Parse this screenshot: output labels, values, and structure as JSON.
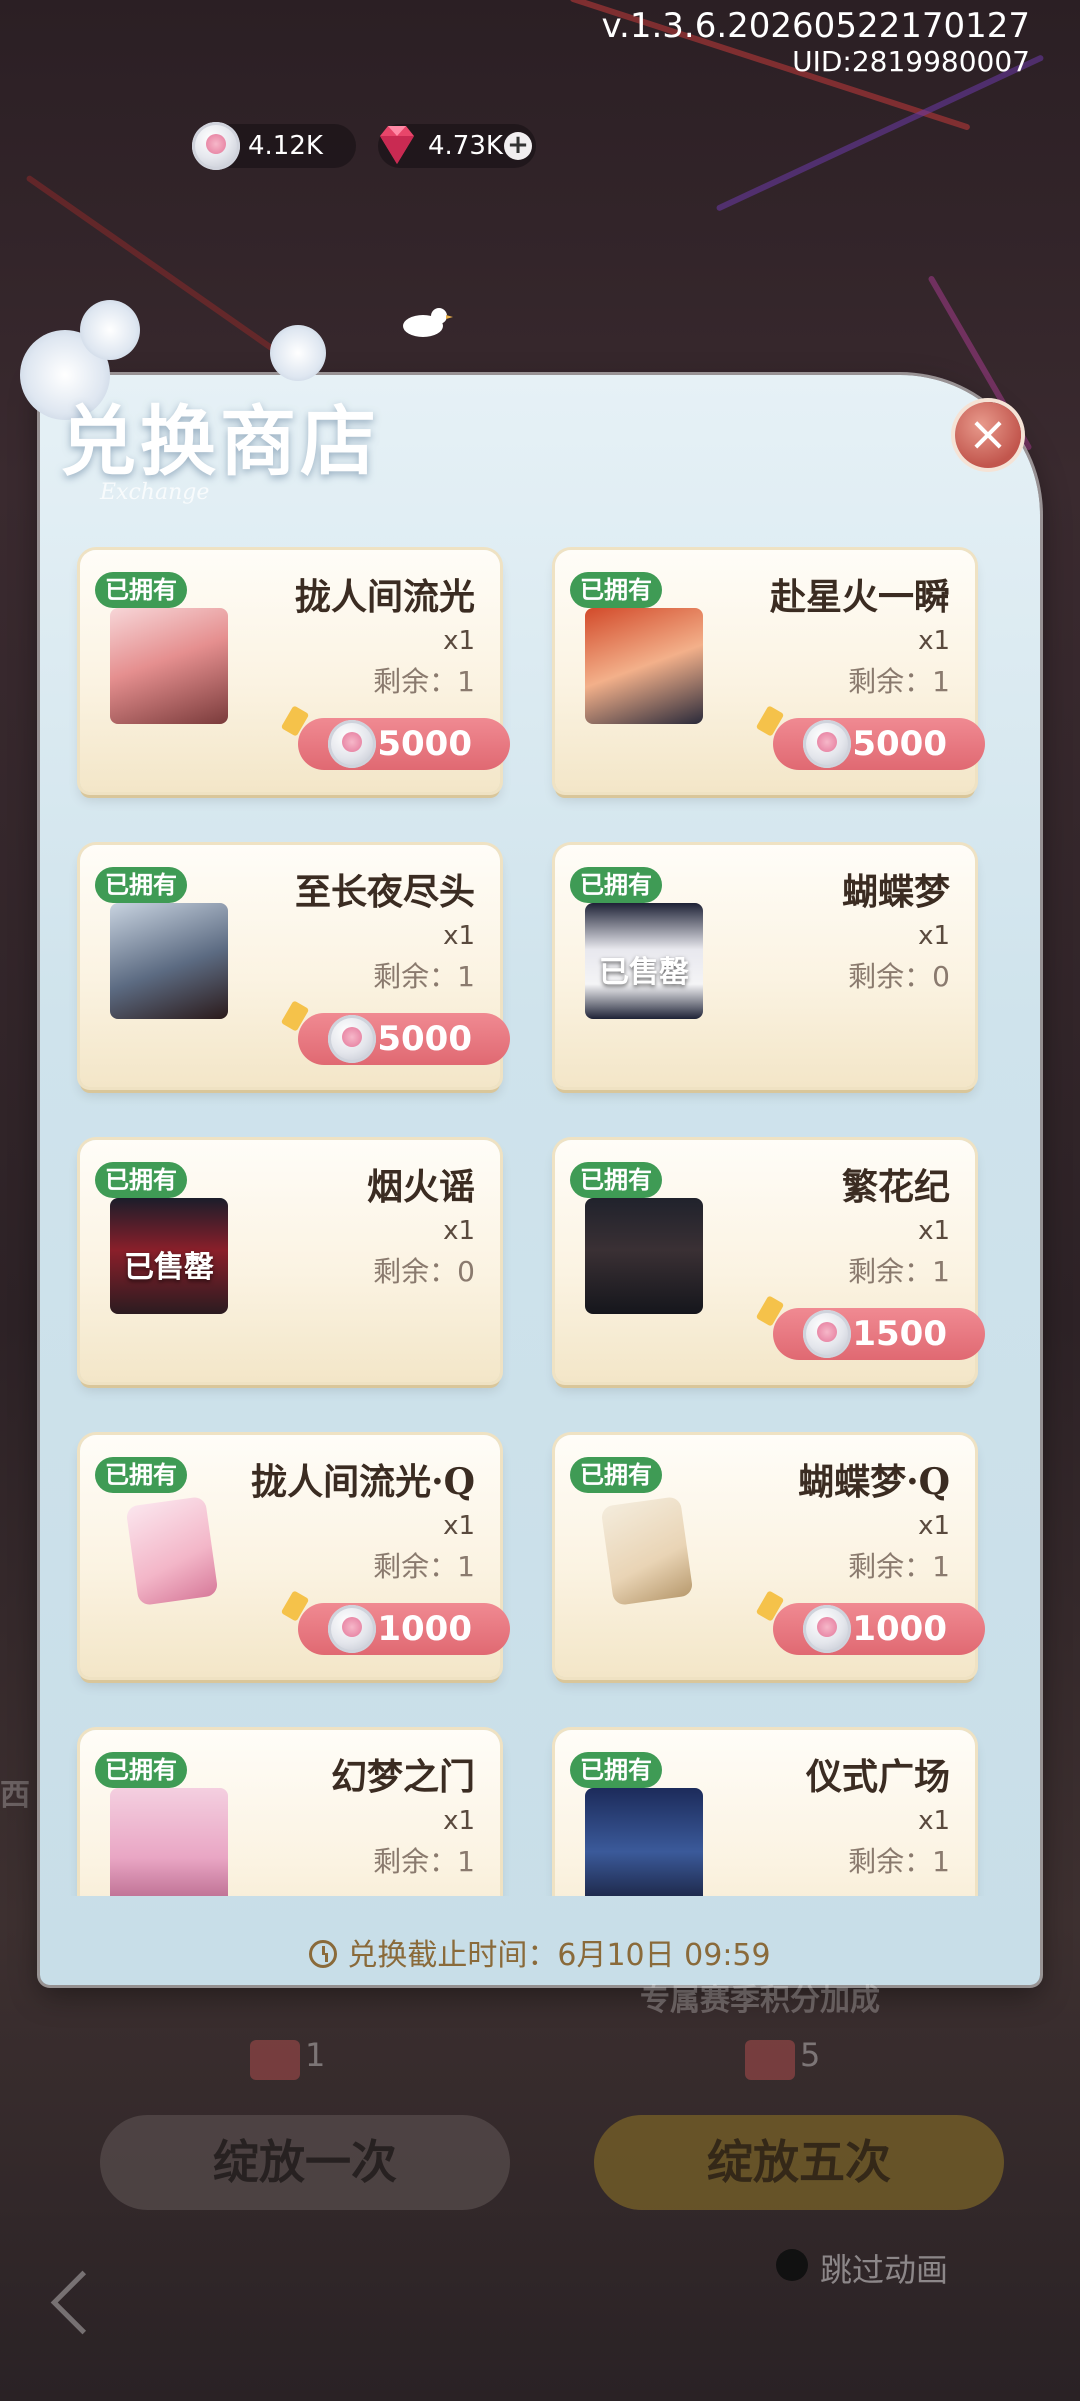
{
  "top_info": {
    "version": "v.1.3.6.20260522170127",
    "uid": "UID:2819980007"
  },
  "currencies": {
    "coin": "4.12K",
    "gem": "4.73K",
    "coin_icon": "silver-rose-coin-icon",
    "gem_icon": "pink-diamond-icon"
  },
  "shop": {
    "title": "兑换商店",
    "subtitle": "Exchange",
    "close_icon": "close-icon",
    "owned_label": "已拥有",
    "sold_out_label": "已售罄",
    "items": [
      {
        "name": "拢人间流光",
        "qty": "x1",
        "remain": "剩余：1",
        "price": "5000",
        "sold_out": false,
        "thumb": "portrait-pink-hair"
      },
      {
        "name": "赴星火一瞬",
        "qty": "x1",
        "remain": "剩余：1",
        "price": "5000",
        "sold_out": false,
        "thumb": "portrait-orange-hair"
      },
      {
        "name": "至长夜尽头",
        "qty": "x1",
        "remain": "剩余：1",
        "price": "5000",
        "sold_out": false,
        "thumb": "portrait-silver-hair"
      },
      {
        "name": "蝴蝶梦",
        "qty": "x1",
        "remain": "剩余：0",
        "price": "",
        "sold_out": true,
        "thumb": "outfit-white-suit"
      },
      {
        "name": "烟火谣",
        "qty": "x1",
        "remain": "剩余：0",
        "price": "",
        "sold_out": true,
        "thumb": "outfit-red-uniform"
      },
      {
        "name": "繁花纪",
        "qty": "x1",
        "remain": "剩余：1",
        "price": "1500",
        "sold_out": false,
        "thumb": "outfit-dark-coat"
      },
      {
        "name": "拢人间流光·Q",
        "qty": "x1",
        "remain": "剩余：1",
        "price": "1000",
        "sold_out": false,
        "thumb": "chibi-card-pink"
      },
      {
        "name": "蝴蝶梦·Q",
        "qty": "x1",
        "remain": "剩余：1",
        "price": "1000",
        "sold_out": false,
        "thumb": "chibi-card-fashion"
      },
      {
        "name": "幻梦之门",
        "qty": "x1",
        "remain": "剩余：1",
        "price": "",
        "sold_out": false,
        "thumb": "scene-pink-room"
      },
      {
        "name": "仪式广场",
        "qty": "x1",
        "remain": "剩余：1",
        "price": "",
        "sold_out": false,
        "thumb": "scene-blue-plaza"
      }
    ],
    "deadline": "兑换截止时间：6月10日 09:59"
  },
  "bottom": {
    "bloom_once": "绽放一次",
    "bloom_five": "绽放五次",
    "ticket_once": "1",
    "ticket_five": "5",
    "bonus_text": "专属赛季积分加成",
    "skip_animation": "跳过动画"
  },
  "colors": {
    "owned_badge": "#3f9b55",
    "price_pill": "#e06972",
    "close_button": "#c2564d",
    "deadline_text": "#8a6a3a"
  }
}
